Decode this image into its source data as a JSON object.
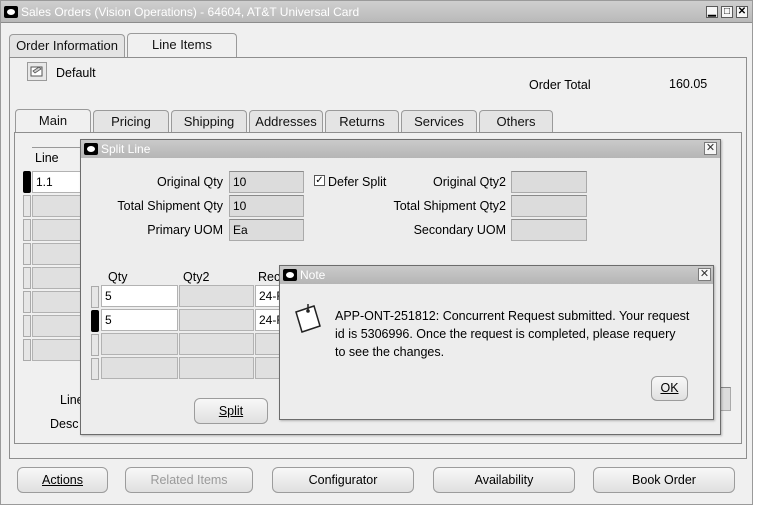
{
  "window": {
    "title": "Sales Orders (Vision Operations) - 64604, AT&T Universal Card",
    "minimize": "▁",
    "maximize": "□",
    "close": "✕"
  },
  "top_tabs": [
    {
      "label": "Order Information"
    },
    {
      "label": "Line Items"
    }
  ],
  "header": {
    "default_label": "Default",
    "order_total_label": "Order Total",
    "order_total_value": "160.05"
  },
  "sub_tabs": [
    {
      "label": "Main"
    },
    {
      "label": "Pricing"
    },
    {
      "label": "Shipping"
    },
    {
      "label": "Addresses"
    },
    {
      "label": "Returns"
    },
    {
      "label": "Services"
    },
    {
      "label": "Others"
    }
  ],
  "lines_grid": {
    "col_line": "Line",
    "first_value": "1.1"
  },
  "bottom_labels": {
    "line_label_partial": "Line",
    "desc_label_partial": "Desc"
  },
  "split_dialog": {
    "title": "Split Line",
    "original_qty_label": "Original Qty",
    "original_qty_value": "10",
    "total_shipment_qty_label": "Total Shipment Qty",
    "total_shipment_qty_value": "10",
    "primary_uom_label": "Primary UOM",
    "primary_uom_value": "Ea",
    "defer_split_label": "Defer Split",
    "defer_split_checked": true,
    "original_qty2_label": "Original Qty2",
    "total_shipment_qty2_label": "Total Shipment Qty2",
    "secondary_uom_label": "Secondary UOM",
    "col_qty": "Qty",
    "col_qty2": "Qty2",
    "col_req_partial": "Rec",
    "rows": [
      {
        "qty": "5",
        "req": "24-F"
      },
      {
        "qty": "5",
        "req": "24-F"
      }
    ],
    "split_button": "Split",
    "split_button_underline": "S"
  },
  "note_dialog": {
    "title": "Note",
    "message_line1": "APP-ONT-251812: Concurrent Request submitted. Your request",
    "message_line2": "id is 5306996. Once the request is completed, please requery",
    "message_line3": "to see the changes.",
    "ok_button": "OK"
  },
  "footer_buttons": [
    {
      "label": "Actions",
      "enabled": true
    },
    {
      "label": "Related Items",
      "enabled": false
    },
    {
      "label": "Configurator",
      "enabled": true
    },
    {
      "label": "Availability",
      "enabled": true
    },
    {
      "label": "Book Order",
      "enabled": true
    }
  ]
}
